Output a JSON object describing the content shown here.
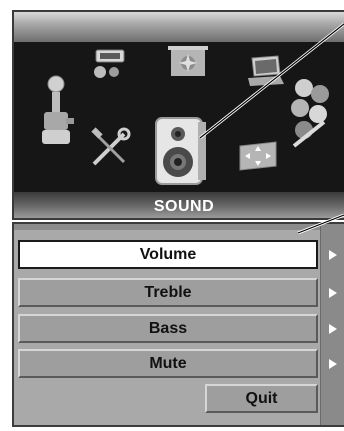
{
  "icon_panel": {
    "selected_label": "SOUND",
    "icons": [
      {
        "name": "joystick-icon"
      },
      {
        "name": "projector-input-icon"
      },
      {
        "name": "picture-screen-icon"
      },
      {
        "name": "laptop-icon"
      },
      {
        "name": "tools-icon"
      },
      {
        "name": "speaker-icon"
      },
      {
        "name": "screen-adjust-icon"
      },
      {
        "name": "color-balls-icon"
      }
    ]
  },
  "submenu": {
    "items": [
      {
        "label": "Volume",
        "selected": true
      },
      {
        "label": "Treble",
        "selected": false
      },
      {
        "label": "Bass",
        "selected": false
      },
      {
        "label": "Mute",
        "selected": false
      }
    ],
    "quit_label": "Quit"
  },
  "colors": {
    "panel_background": "#161616",
    "submenu_background": "#a9a9a9",
    "selected_item": "#ffffff"
  }
}
